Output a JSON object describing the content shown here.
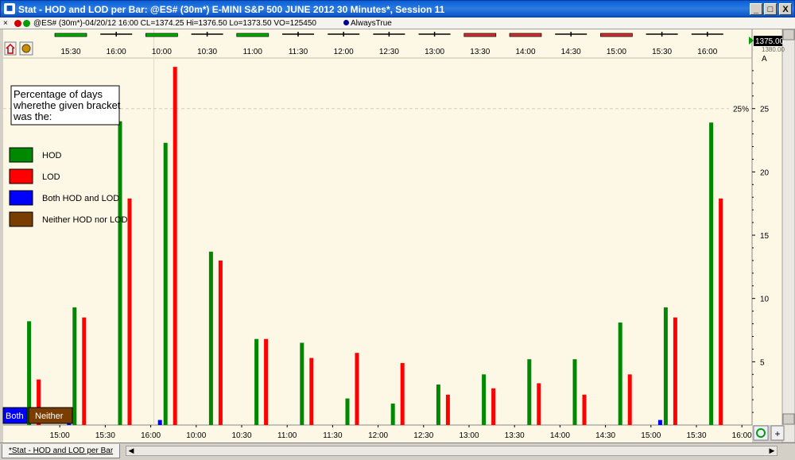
{
  "window": {
    "title": "Stat - HOD and LOD per Bar: @ES# (30m*) E-MINI S&P 500 JUNE 2012 30 Minutes*, Session 11",
    "minimize": "_",
    "maximize": "□",
    "close": "X"
  },
  "infobar": {
    "close": "×",
    "symbol_info": "@ES# (30m*)-04/20/12 16:00 CL=1374.25 Hi=1376.50 Lo=1373.50 VO=125450",
    "indicator": "AlwaysTrue"
  },
  "bottom": {
    "tab_label": "*Stat - HOD and LOD per Bar"
  },
  "colors": {
    "hod": "#008800",
    "lod": "#ff0000",
    "both": "#0000ff",
    "neither": "#7a3d00",
    "background": "#fdf8e6"
  },
  "chart_data": {
    "type": "bar",
    "categories": [
      "15:00",
      "15:30",
      "16:00",
      "10:00",
      "10:30",
      "11:00",
      "11:30",
      "12:00",
      "12:30",
      "13:00",
      "13:30",
      "14:00",
      "14:30",
      "15:00",
      "15:30",
      "16:00"
    ],
    "series": [
      {
        "name": "HOD",
        "values": [
          8.2,
          9.3,
          24.0,
          22.3,
          13.7,
          6.8,
          6.5,
          2.1,
          1.7,
          3.2,
          4.0,
          5.2,
          5.2,
          8.1,
          9.3,
          23.9
        ]
      },
      {
        "name": "LOD",
        "values": [
          3.6,
          8.5,
          17.9,
          28.3,
          13.0,
          6.8,
          5.3,
          5.7,
          4.9,
          2.4,
          2.9,
          3.3,
          2.4,
          4.0,
          8.5,
          17.9
        ]
      },
      {
        "name": "Both HOD and LOD",
        "values": [
          0,
          0.4,
          0,
          0.4,
          0,
          0,
          0,
          0,
          0,
          0,
          0,
          0,
          0,
          0,
          0.4,
          0
        ]
      },
      {
        "name": "Neither HOD nor LOD",
        "values": [
          0,
          0,
          0,
          0,
          0,
          0,
          0,
          0,
          0,
          0,
          0,
          0,
          0,
          0,
          0,
          0
        ]
      }
    ],
    "ylim": [
      0,
      29
    ],
    "yticks": [
      5,
      10,
      15,
      20,
      25
    ],
    "reference_line": {
      "value": 25,
      "label": "25%"
    },
    "legend_title": "Percentage of days wherethe given bracket was the:",
    "legend_placement": "top-left",
    "legend": [
      "HOD",
      "LOD",
      "Both HOD and LOD",
      "Neither HOD nor LOD"
    ],
    "tabs": [
      "Both",
      "Neither"
    ],
    "last_price": "1375.00",
    "right_top_labels": [
      "1380.00",
      "A"
    ],
    "mini_bars": [
      {
        "time": "15:30",
        "kind": "up"
      },
      {
        "time": "16:00",
        "kind": "flat"
      },
      {
        "time": "10:00",
        "kind": "up"
      },
      {
        "time": "10:30",
        "kind": "flat"
      },
      {
        "time": "11:00",
        "kind": "up"
      },
      {
        "time": "11:30",
        "kind": "flat"
      },
      {
        "time": "12:00",
        "kind": "flat"
      },
      {
        "time": "12:30",
        "kind": "flat"
      },
      {
        "time": "13:00",
        "kind": "flat"
      },
      {
        "time": "13:30",
        "kind": "down"
      },
      {
        "time": "14:00",
        "kind": "down"
      },
      {
        "time": "14:30",
        "kind": "flat"
      },
      {
        "time": "15:00",
        "kind": "down"
      },
      {
        "time": "15:30",
        "kind": "flat"
      },
      {
        "time": "16:00",
        "kind": "flat"
      }
    ]
  }
}
